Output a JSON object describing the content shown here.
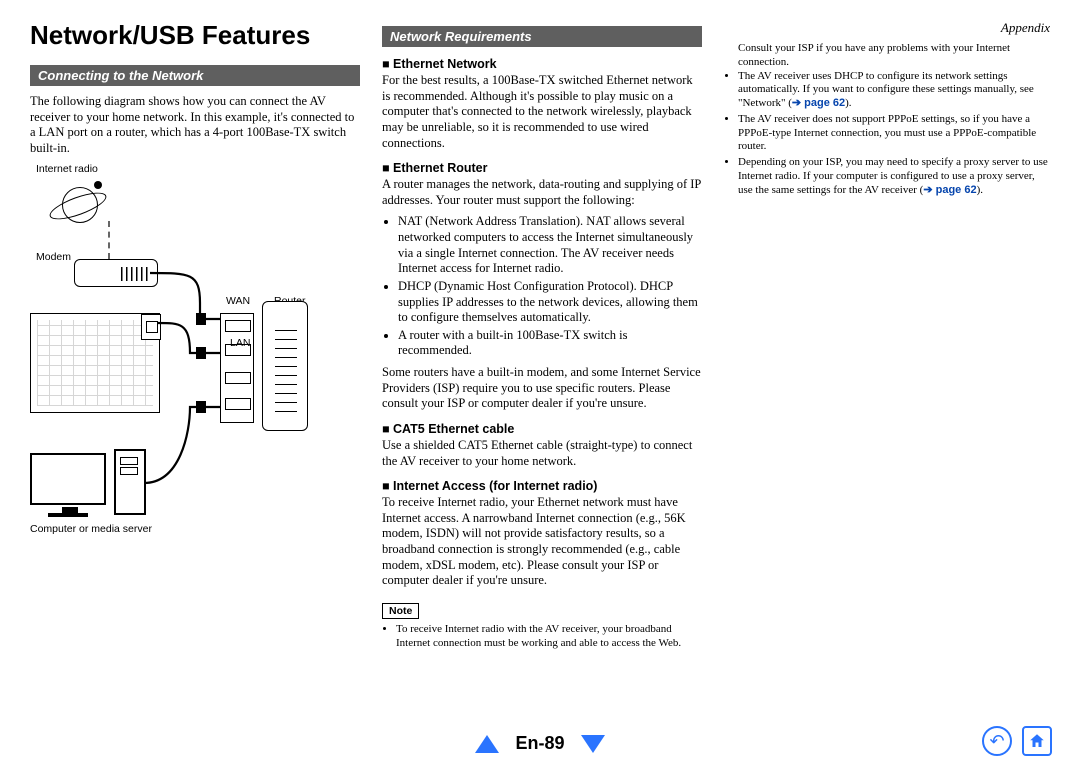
{
  "appendix": "Appendix",
  "title": "Network/USB Features",
  "section1": {
    "heading": "Connecting to the Network",
    "intro": "The following diagram shows how you can connect the AV receiver to your home network. In this example, it's connected to a LAN port on a router, which has a 4-port 100Base-TX switch built-in.",
    "labels": {
      "internet_radio": "Internet radio",
      "modem": "Modem",
      "wan": "WAN",
      "lan": "LAN",
      "router": "Router",
      "computer": "Computer or media server"
    }
  },
  "section2": {
    "heading": "Network Requirements",
    "ethernet_network_h": "Ethernet Network",
    "ethernet_network_p": "For the best results, a 100Base-TX switched Ethernet network is recommended. Although it's possible to play music on a computer that's connected to the network wirelessly, playback may be unreliable, so it is recommended to use wired connections.",
    "ethernet_router_h": "Ethernet Router",
    "ethernet_router_p": "A router manages the network, data-routing and supplying of IP addresses. Your router must support the following:",
    "router_bullets": [
      "NAT (Network Address Translation). NAT allows several networked computers to access the Internet simultaneously via a single Internet connection. The AV receiver needs Internet access for Internet radio.",
      "DHCP (Dynamic Host Configuration Protocol). DHCP supplies IP addresses to the network devices, allowing them to configure themselves automatically.",
      "A router with a built-in 100Base-TX switch is recommended."
    ],
    "router_after": "Some routers have a built-in modem, and some Internet Service Providers (ISP) require you to use specific routers. Please consult your ISP or computer dealer if you're unsure.",
    "cat5_h": "CAT5 Ethernet cable",
    "cat5_p": "Use a shielded CAT5 Ethernet cable (straight-type) to connect the AV receiver to your home network.",
    "internet_h": "Internet Access (for Internet radio)",
    "internet_p": "To receive Internet radio, your Ethernet network must have Internet access. A narrowband Internet connection (e.g., 56K modem, ISDN) will not provide satisfactory results, so a broadband connection is strongly recommended (e.g., cable modem, xDSL modem, etc). Please consult your ISP or computer dealer if you're unsure.",
    "note_label": "Note",
    "note_bullet": "To receive Internet radio with the AV receiver, your broadband Internet connection must be working and able to access the Web."
  },
  "col3": {
    "first": "Consult your ISP if you have any problems with your Internet connection.",
    "b1a": "The AV receiver uses DHCP to configure its network settings automatically. If you want to configure these settings manually, see \"Network\" (",
    "b1link": "➔ page 62",
    "b1b": ").",
    "b2": "The AV receiver does not support PPPoE settings, so if you have a PPPoE-type Internet connection, you must use a PPPoE-compatible router.",
    "b3a": "Depending on your ISP, you may need to specify a proxy server to use Internet radio. If your computer is configured to use a proxy server, use the same settings for the AV receiver (",
    "b3link": "➔ page 62",
    "b3b": ")."
  },
  "footer": {
    "page": "En-89"
  }
}
